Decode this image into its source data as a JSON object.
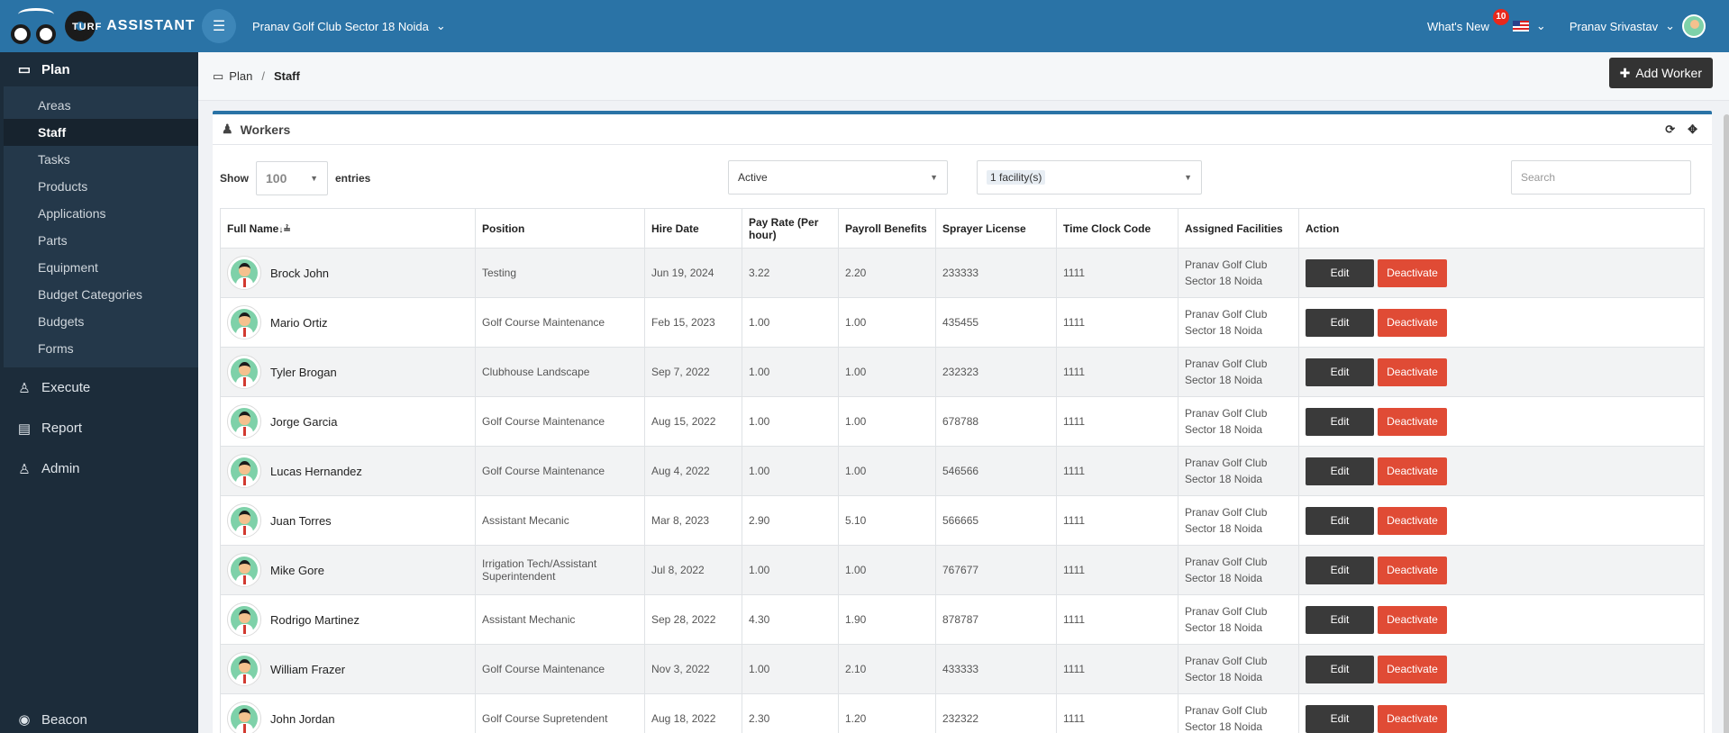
{
  "header": {
    "brand_turf": "TURF",
    "brand_assistant": "ASSISTANT",
    "club": "Pranav Golf Club Sector 18 Noida",
    "whats_new": "What's New",
    "whats_new_count": "10",
    "user_name": "Pranav Srivastav"
  },
  "sidebar": {
    "plan": "Plan",
    "plan_items": [
      {
        "label": "Areas"
      },
      {
        "label": "Staff",
        "active": true
      },
      {
        "label": "Tasks"
      },
      {
        "label": "Products"
      },
      {
        "label": "Applications"
      },
      {
        "label": "Parts"
      },
      {
        "label": "Equipment"
      },
      {
        "label": "Budget Categories"
      },
      {
        "label": "Budgets"
      },
      {
        "label": "Forms"
      }
    ],
    "execute": "Execute",
    "report": "Report",
    "admin": "Admin",
    "beacon": "Beacon"
  },
  "breadcrumb": {
    "parent": "Plan",
    "separator": "/",
    "current": "Staff"
  },
  "add_worker": "Add Worker",
  "panel": {
    "title": "Workers",
    "show_label": "Show",
    "entries_label": "entries",
    "page_size": "100",
    "status_filter": "Active",
    "facility_filter": "1 facility(s)",
    "search_placeholder": "Search"
  },
  "table": {
    "columns": [
      "Full Name",
      "Position",
      "Hire Date",
      "Pay Rate (Per hour)",
      "Payroll Benefits",
      "Sprayer License",
      "Time Clock Code",
      "Assigned Facilities",
      "Action"
    ],
    "sort_indicator": "↓≟",
    "edit_label": "Edit",
    "deactivate_label": "Deactivate",
    "rows": [
      {
        "name": "Brock John",
        "position": "Testing",
        "hire_date": "Jun 19, 2024",
        "pay_rate": "3.22",
        "benefits": "2.20",
        "license": "233333",
        "clock": "1111",
        "facility": "Pranav Golf Club Sector 18 Noida"
      },
      {
        "name": "Mario Ortiz",
        "position": "Golf Course Maintenance",
        "hire_date": "Feb 15, 2023",
        "pay_rate": "1.00",
        "benefits": "1.00",
        "license": "435455",
        "clock": "1111",
        "facility": "Pranav Golf Club Sector 18 Noida"
      },
      {
        "name": "Tyler Brogan",
        "position": "Clubhouse Landscape",
        "hire_date": "Sep 7, 2022",
        "pay_rate": "1.00",
        "benefits": "1.00",
        "license": "232323",
        "clock": "1111",
        "facility": "Pranav Golf Club Sector 18 Noida"
      },
      {
        "name": "Jorge Garcia",
        "position": "Golf Course Maintenance",
        "hire_date": "Aug 15, 2022",
        "pay_rate": "1.00",
        "benefits": "1.00",
        "license": "678788",
        "clock": "1111",
        "facility": "Pranav Golf Club Sector 18 Noida"
      },
      {
        "name": "Lucas Hernandez",
        "position": "Golf Course Maintenance",
        "hire_date": "Aug 4, 2022",
        "pay_rate": "1.00",
        "benefits": "1.00",
        "license": "546566",
        "clock": "1111",
        "facility": "Pranav Golf Club Sector 18 Noida"
      },
      {
        "name": "Juan Torres",
        "position": "Assistant Mecanic",
        "hire_date": "Mar 8, 2023",
        "pay_rate": "2.90",
        "benefits": "5.10",
        "license": "566665",
        "clock": "1111",
        "facility": "Pranav Golf Club Sector 18 Noida"
      },
      {
        "name": "Mike Gore",
        "position": "Irrigation Tech/Assistant Superintendent",
        "hire_date": "Jul 8, 2022",
        "pay_rate": "1.00",
        "benefits": "1.00",
        "license": "767677",
        "clock": "1111",
        "facility": "Pranav Golf Club Sector 18 Noida"
      },
      {
        "name": "Rodrigo Martinez",
        "position": "Assistant Mechanic",
        "hire_date": "Sep 28, 2022",
        "pay_rate": "4.30",
        "benefits": "1.90",
        "license": "878787",
        "clock": "1111",
        "facility": "Pranav Golf Club Sector 18 Noida"
      },
      {
        "name": "William Frazer",
        "position": "Golf Course Maintenance",
        "hire_date": "Nov 3, 2022",
        "pay_rate": "1.00",
        "benefits": "2.10",
        "license": "433333",
        "clock": "1111",
        "facility": "Pranav Golf Club Sector 18 Noida"
      },
      {
        "name": "John Jordan",
        "position": "Golf Course Supretendent",
        "hire_date": "Aug 18, 2022",
        "pay_rate": "2.30",
        "benefits": "1.20",
        "license": "232322",
        "clock": "1111",
        "facility": "Pranav Golf Club Sector 18 Noida"
      }
    ]
  },
  "colors": {
    "topbar": "#2a73a6",
    "sidebar": "#1c2c3a",
    "deactivate": "#e04b35",
    "edit": "#3a3a3a"
  }
}
